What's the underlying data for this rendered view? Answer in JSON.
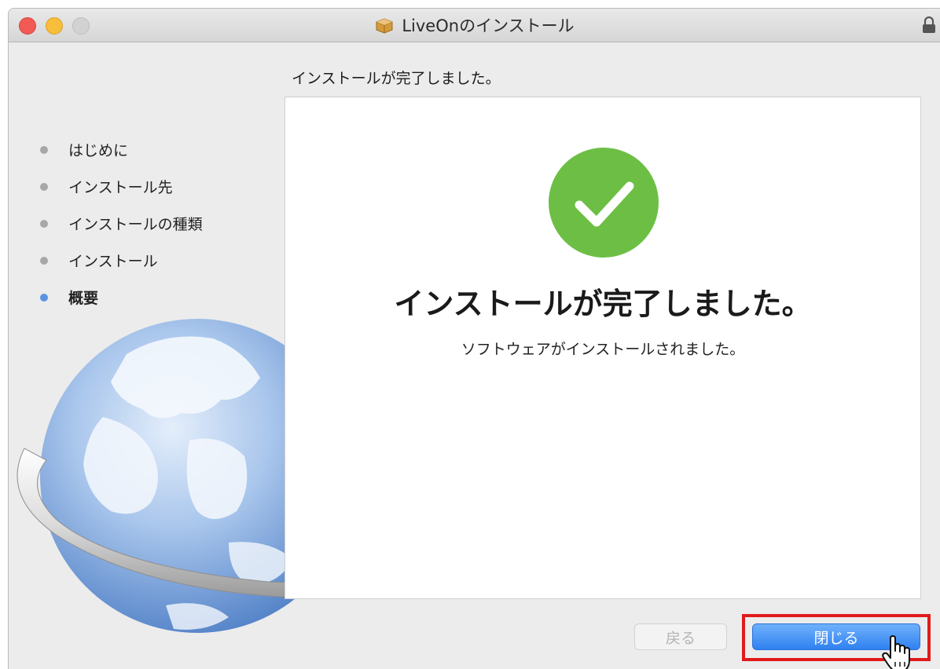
{
  "window": {
    "title": "LiveOnのインストール",
    "title_icon": "package-icon",
    "lock_icon": "lock-icon"
  },
  "heading": "インストールが完了しました。",
  "steps": [
    {
      "label": "はじめに",
      "state": "done"
    },
    {
      "label": "インストール先",
      "state": "done"
    },
    {
      "label": "インストールの種類",
      "state": "done"
    },
    {
      "label": "インストール",
      "state": "done"
    },
    {
      "label": "概要",
      "state": "current"
    }
  ],
  "panel": {
    "icon": "checkmark-circle-icon",
    "main_message": "インストールが完了しました。",
    "sub_message": "ソフトウェアがインストールされました。"
  },
  "buttons": {
    "back_label": "戻る",
    "back_enabled": false,
    "close_label": "閉じる"
  },
  "colors": {
    "accent_blue": "#2f81f1",
    "success_green": "#6cbf44",
    "highlight_red": "#e01b1b",
    "current_step_dot": "#5b93e2"
  }
}
